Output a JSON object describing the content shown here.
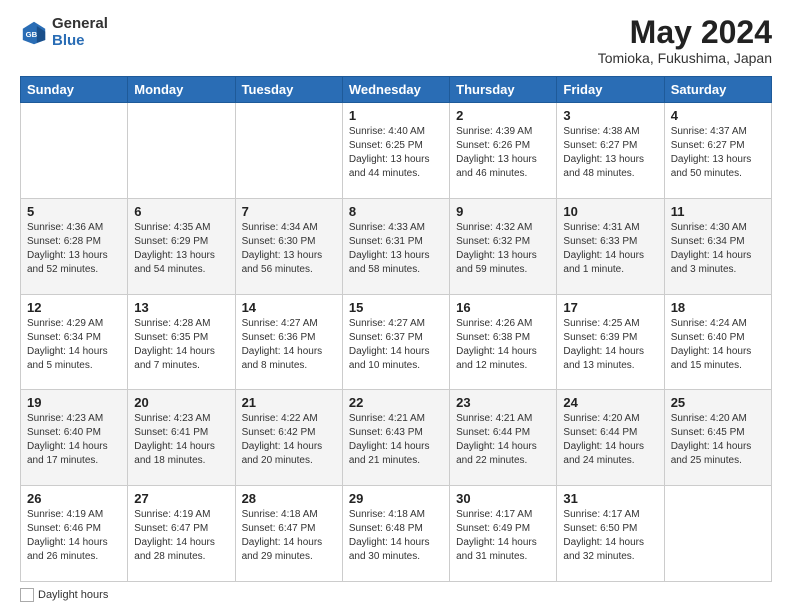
{
  "header": {
    "logo_line1": "General",
    "logo_line2": "Blue",
    "month_year": "May 2024",
    "location": "Tomioka, Fukushima, Japan"
  },
  "weekdays": [
    "Sunday",
    "Monday",
    "Tuesday",
    "Wednesday",
    "Thursday",
    "Friday",
    "Saturday"
  ],
  "weeks": [
    [
      {
        "day": "",
        "info": ""
      },
      {
        "day": "",
        "info": ""
      },
      {
        "day": "",
        "info": ""
      },
      {
        "day": "1",
        "info": "Sunrise: 4:40 AM\nSunset: 6:25 PM\nDaylight: 13 hours\nand 44 minutes."
      },
      {
        "day": "2",
        "info": "Sunrise: 4:39 AM\nSunset: 6:26 PM\nDaylight: 13 hours\nand 46 minutes."
      },
      {
        "day": "3",
        "info": "Sunrise: 4:38 AM\nSunset: 6:27 PM\nDaylight: 13 hours\nand 48 minutes."
      },
      {
        "day": "4",
        "info": "Sunrise: 4:37 AM\nSunset: 6:27 PM\nDaylight: 13 hours\nand 50 minutes."
      }
    ],
    [
      {
        "day": "5",
        "info": "Sunrise: 4:36 AM\nSunset: 6:28 PM\nDaylight: 13 hours\nand 52 minutes."
      },
      {
        "day": "6",
        "info": "Sunrise: 4:35 AM\nSunset: 6:29 PM\nDaylight: 13 hours\nand 54 minutes."
      },
      {
        "day": "7",
        "info": "Sunrise: 4:34 AM\nSunset: 6:30 PM\nDaylight: 13 hours\nand 56 minutes."
      },
      {
        "day": "8",
        "info": "Sunrise: 4:33 AM\nSunset: 6:31 PM\nDaylight: 13 hours\nand 58 minutes."
      },
      {
        "day": "9",
        "info": "Sunrise: 4:32 AM\nSunset: 6:32 PM\nDaylight: 13 hours\nand 59 minutes."
      },
      {
        "day": "10",
        "info": "Sunrise: 4:31 AM\nSunset: 6:33 PM\nDaylight: 14 hours\nand 1 minute."
      },
      {
        "day": "11",
        "info": "Sunrise: 4:30 AM\nSunset: 6:34 PM\nDaylight: 14 hours\nand 3 minutes."
      }
    ],
    [
      {
        "day": "12",
        "info": "Sunrise: 4:29 AM\nSunset: 6:34 PM\nDaylight: 14 hours\nand 5 minutes."
      },
      {
        "day": "13",
        "info": "Sunrise: 4:28 AM\nSunset: 6:35 PM\nDaylight: 14 hours\nand 7 minutes."
      },
      {
        "day": "14",
        "info": "Sunrise: 4:27 AM\nSunset: 6:36 PM\nDaylight: 14 hours\nand 8 minutes."
      },
      {
        "day": "15",
        "info": "Sunrise: 4:27 AM\nSunset: 6:37 PM\nDaylight: 14 hours\nand 10 minutes."
      },
      {
        "day": "16",
        "info": "Sunrise: 4:26 AM\nSunset: 6:38 PM\nDaylight: 14 hours\nand 12 minutes."
      },
      {
        "day": "17",
        "info": "Sunrise: 4:25 AM\nSunset: 6:39 PM\nDaylight: 14 hours\nand 13 minutes."
      },
      {
        "day": "18",
        "info": "Sunrise: 4:24 AM\nSunset: 6:40 PM\nDaylight: 14 hours\nand 15 minutes."
      }
    ],
    [
      {
        "day": "19",
        "info": "Sunrise: 4:23 AM\nSunset: 6:40 PM\nDaylight: 14 hours\nand 17 minutes."
      },
      {
        "day": "20",
        "info": "Sunrise: 4:23 AM\nSunset: 6:41 PM\nDaylight: 14 hours\nand 18 minutes."
      },
      {
        "day": "21",
        "info": "Sunrise: 4:22 AM\nSunset: 6:42 PM\nDaylight: 14 hours\nand 20 minutes."
      },
      {
        "day": "22",
        "info": "Sunrise: 4:21 AM\nSunset: 6:43 PM\nDaylight: 14 hours\nand 21 minutes."
      },
      {
        "day": "23",
        "info": "Sunrise: 4:21 AM\nSunset: 6:44 PM\nDaylight: 14 hours\nand 22 minutes."
      },
      {
        "day": "24",
        "info": "Sunrise: 4:20 AM\nSunset: 6:44 PM\nDaylight: 14 hours\nand 24 minutes."
      },
      {
        "day": "25",
        "info": "Sunrise: 4:20 AM\nSunset: 6:45 PM\nDaylight: 14 hours\nand 25 minutes."
      }
    ],
    [
      {
        "day": "26",
        "info": "Sunrise: 4:19 AM\nSunset: 6:46 PM\nDaylight: 14 hours\nand 26 minutes."
      },
      {
        "day": "27",
        "info": "Sunrise: 4:19 AM\nSunset: 6:47 PM\nDaylight: 14 hours\nand 28 minutes."
      },
      {
        "day": "28",
        "info": "Sunrise: 4:18 AM\nSunset: 6:47 PM\nDaylight: 14 hours\nand 29 minutes."
      },
      {
        "day": "29",
        "info": "Sunrise: 4:18 AM\nSunset: 6:48 PM\nDaylight: 14 hours\nand 30 minutes."
      },
      {
        "day": "30",
        "info": "Sunrise: 4:17 AM\nSunset: 6:49 PM\nDaylight: 14 hours\nand 31 minutes."
      },
      {
        "day": "31",
        "info": "Sunrise: 4:17 AM\nSunset: 6:50 PM\nDaylight: 14 hours\nand 32 minutes."
      },
      {
        "day": "",
        "info": ""
      }
    ]
  ],
  "footer": {
    "daylight_label": "Daylight hours"
  }
}
